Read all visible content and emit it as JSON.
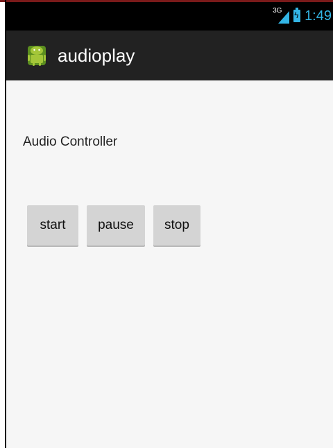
{
  "status_bar": {
    "network": "3G",
    "time": "1:49"
  },
  "action_bar": {
    "app_icon": "android-robot-icon",
    "title": "audioplay"
  },
  "content": {
    "heading": "Audio Controller",
    "buttons": {
      "start": "start",
      "pause": "pause",
      "stop": "stop"
    }
  },
  "colors": {
    "accent": "#33b5e5",
    "action_bar_bg": "#222222",
    "content_bg": "#f6f6f6",
    "button_bg": "#d4d4d4"
  }
}
